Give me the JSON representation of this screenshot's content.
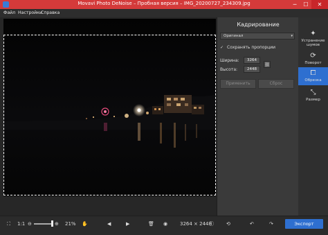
{
  "titlebar": {
    "title": "Movavi Photo DeNoise – Пробная версия – IMG_20200727_234309.jpg"
  },
  "menu": [
    "Файл",
    "Настройки",
    "Справка"
  ],
  "panel": {
    "title": "Кадрирование",
    "preset": "Оригинал",
    "keep_ratio_label": "Сохранять пропорции",
    "width_label": "Ширина:",
    "width_value": "3264",
    "height_label": "Высота:",
    "height_value": "2448",
    "apply_label": "Применить",
    "reset_label": "Сброс"
  },
  "tools": [
    {
      "label": "Устранение шумов",
      "icon": "denoise-icon"
    },
    {
      "label": "Поворот",
      "icon": "rotate-icon"
    },
    {
      "label": "Обрезка",
      "icon": "crop-icon",
      "active": true
    },
    {
      "label": "Размер",
      "icon": "resize-icon"
    }
  ],
  "bottom": {
    "ratio_label": "1:1",
    "zoom": "21%",
    "dimensions": "3264 × 2448",
    "export_label": "Экспорт"
  },
  "colors": {
    "titlebar": "#d43a3a",
    "accent": "#2e6fd0"
  }
}
